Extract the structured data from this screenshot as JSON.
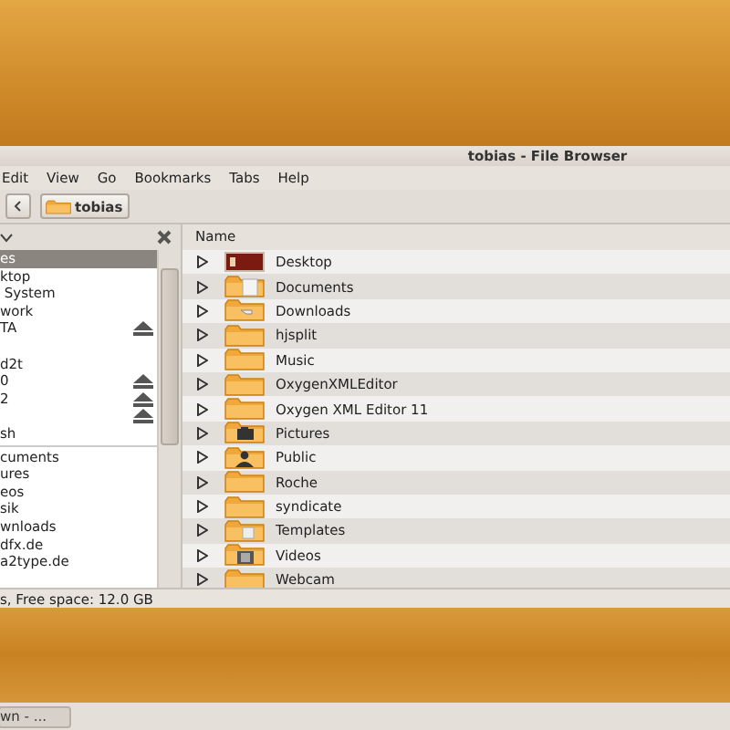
{
  "window": {
    "title": "tobias - File Browser"
  },
  "menu": [
    "Edit",
    "View",
    "Go",
    "Bookmarks",
    "Tabs",
    "Help"
  ],
  "toolbar": {
    "path_button": "tobias"
  },
  "sidebar": {
    "places": [
      {
        "label": "es",
        "selected": true,
        "eject": false
      },
      {
        "label": "ktop",
        "selected": false,
        "eject": false
      },
      {
        "label": " System",
        "selected": false,
        "eject": false
      },
      {
        "label": "work",
        "selected": false,
        "eject": false
      },
      {
        "label": "TA",
        "selected": false,
        "eject": true
      },
      {
        "label": "d2t",
        "selected": false,
        "eject": false
      },
      {
        "label": "0",
        "selected": false,
        "eject": true
      },
      {
        "label": "2",
        "selected": false,
        "eject": true
      },
      {
        "selected": false,
        "eject": true
      },
      {
        "label": "sh",
        "selected": false,
        "eject": false
      }
    ],
    "bookmarks": [
      {
        "label": "cuments",
        "selected": false
      },
      {
        "label": "ures",
        "selected": false
      },
      {
        "label": "eos",
        "selected": false
      },
      {
        "label": "sik",
        "selected": false
      },
      {
        "label": "wnloads",
        "selected": false
      },
      {
        "label": "dfx.de",
        "selected": false
      },
      {
        "label": "a2type.de",
        "selected": false
      }
    ]
  },
  "list": {
    "columns": [
      "Name"
    ],
    "rows": [
      {
        "name": "Desktop",
        "kind": "desktop"
      },
      {
        "name": "Documents",
        "kind": "documents"
      },
      {
        "name": "Downloads",
        "kind": "downloads"
      },
      {
        "name": "hjsplit",
        "kind": "folder"
      },
      {
        "name": "Music",
        "kind": "folder"
      },
      {
        "name": "OxygenXMLEditor",
        "kind": "folder"
      },
      {
        "name": "Oxygen XML Editor 11",
        "kind": "folder"
      },
      {
        "name": "Pictures",
        "kind": "pictures"
      },
      {
        "name": "Public",
        "kind": "public"
      },
      {
        "name": "Roche",
        "kind": "folder"
      },
      {
        "name": "syndicate",
        "kind": "folder"
      },
      {
        "name": "Templates",
        "kind": "templates"
      },
      {
        "name": "Videos",
        "kind": "videos"
      },
      {
        "name": "Webcam",
        "kind": "folder"
      }
    ]
  },
  "status_bar": "s, Free space: 12.0 GB",
  "taskbar": {
    "button": "wn - ..."
  }
}
